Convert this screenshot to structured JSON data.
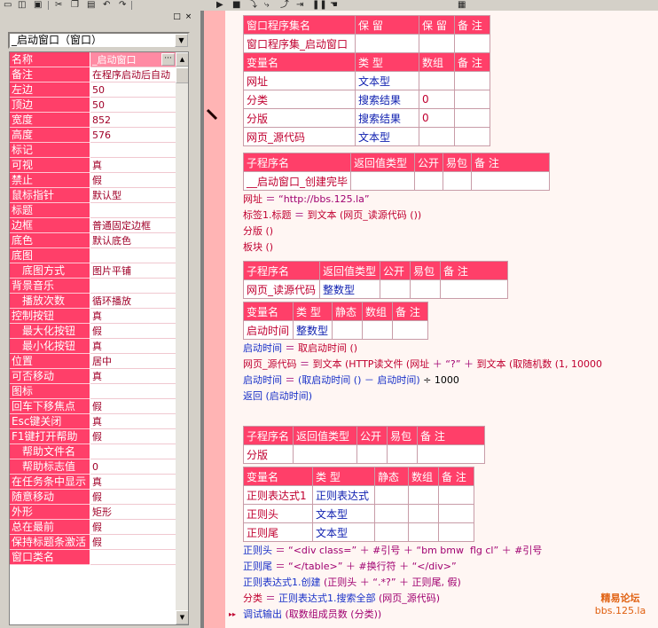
{
  "toolbar": {
    "icons": [
      "new-file-icon",
      "open-file-icon",
      "save-icon",
      "cut-icon",
      "copy-icon",
      "paste-icon",
      "undo-icon",
      "redo-icon",
      "run-icon",
      "stop-icon",
      "step-icon",
      "step-into-icon",
      "step-out-icon",
      "run-to-cursor-icon",
      "pause-icon",
      "hand-icon",
      "app-icon"
    ]
  },
  "left_panel": {
    "close_glyph": "×",
    "restore_glyph": "□",
    "object_selector": "_启动窗口（窗口）",
    "properties": [
      {
        "name": "名称",
        "value": "_启动窗口",
        "has_button": true
      },
      {
        "name": "备注",
        "value": "在程序启动后自动"
      },
      {
        "name": "左边",
        "value": "50"
      },
      {
        "name": "顶边",
        "value": "50"
      },
      {
        "name": "宽度",
        "value": "852"
      },
      {
        "name": "高度",
        "value": "576"
      },
      {
        "name": "标记",
        "value": ""
      },
      {
        "name": "可视",
        "value": "真"
      },
      {
        "name": "禁止",
        "value": "假"
      },
      {
        "name": "鼠标指针",
        "value": "默认型"
      },
      {
        "name": "标题",
        "value": ""
      },
      {
        "name": "边框",
        "value": "普通固定边框"
      },
      {
        "name": "底色",
        "value": "默认底色"
      },
      {
        "name": "底图",
        "value": ""
      },
      {
        "name": "底图方式",
        "value": "图片平铺",
        "sub": true
      },
      {
        "name": "背景音乐",
        "value": ""
      },
      {
        "name": "播放次数",
        "value": "循环播放",
        "sub": true
      },
      {
        "name": "控制按钮",
        "value": "真"
      },
      {
        "name": "最大化按钮",
        "value": "假",
        "sub": true
      },
      {
        "name": "最小化按钮",
        "value": "真",
        "sub": true
      },
      {
        "name": "位置",
        "value": "居中"
      },
      {
        "name": "可否移动",
        "value": "真"
      },
      {
        "name": "图标",
        "value": ""
      },
      {
        "name": "回车下移焦点",
        "value": "假"
      },
      {
        "name": "Esc键关闭",
        "value": "真"
      },
      {
        "name": "F1键打开帮助",
        "value": "假"
      },
      {
        "name": "帮助文件名",
        "value": "",
        "sub": true
      },
      {
        "name": "帮助标志值",
        "value": "0",
        "sub": true
      },
      {
        "name": "在任务条中显示",
        "value": "真"
      },
      {
        "name": "随意移动",
        "value": "假"
      },
      {
        "name": "外形",
        "value": "矩形"
      },
      {
        "name": "总在最前",
        "value": "假"
      },
      {
        "name": "保持标题条激活",
        "value": "假"
      },
      {
        "name": "窗口类名",
        "value": ""
      }
    ]
  },
  "editor": {
    "assembly_table": {
      "header": [
        "窗口程序集名",
        "保 留",
        "保 留",
        "备 注"
      ],
      "row": [
        "窗口程序集_启动窗口",
        "",
        "",
        ""
      ],
      "var_header": [
        "变量名",
        "类 型",
        "数组",
        "备 注"
      ],
      "vars": [
        [
          "网址",
          "文本型",
          "",
          ""
        ],
        [
          "分类",
          "搜索结果",
          "0",
          ""
        ],
        [
          "分版",
          "搜索结果",
          "0",
          ""
        ],
        [
          "网页_源代码",
          "文本型",
          "",
          ""
        ]
      ]
    },
    "sub1_table": {
      "header": [
        "子程序名",
        "返回值类型",
        "公开",
        "易包",
        "备 注"
      ],
      "row": [
        "__启动窗口_创建完毕",
        "",
        "",
        "",
        ""
      ]
    },
    "sub1_code": [
      "网址 ＝ “http://bbs.125.la”",
      "标签1.标题 ＝ 到文本 (网页_读源代码 ())",
      "分版 ()",
      "板块 ()"
    ],
    "sub2_table": {
      "header": [
        "子程序名",
        "返回值类型",
        "公开",
        "易包",
        "备 注"
      ],
      "row": [
        "网页_读源代码",
        "整数型",
        "",
        "",
        ""
      ],
      "var_header": [
        "变量名",
        "类 型",
        "静态",
        "数组",
        "备 注"
      ],
      "vars": [
        [
          "启动时间",
          "整数型",
          "",
          "",
          ""
        ]
      ]
    },
    "sub2_code": [
      "启动时间 ＝ 取启动时间 ()",
      "网页_源代码 ＝ 到文本 (HTTP读文件 (网址 ＋ “?” ＋ 到文本 (取随机数 (1, 10000",
      "启动时间 ＝ (取启动时间 () － 启动时间) ÷ 1000",
      "返回 (启动时间)"
    ],
    "sub3_table": {
      "header": [
        "子程序名",
        "返回值类型",
        "公开",
        "易包",
        "备 注"
      ],
      "row": [
        "分版",
        "",
        "",
        "",
        ""
      ],
      "var_header": [
        "变量名",
        "类 型",
        "静态",
        "数组",
        "备 注"
      ],
      "vars": [
        [
          "正则表达式1",
          "正则表达式",
          "",
          "",
          ""
        ],
        [
          "正则头",
          "文本型",
          "",
          "",
          ""
        ],
        [
          "正则尾",
          "文本型",
          "",
          "",
          ""
        ]
      ]
    },
    "sub3_code": [
      "正则头 ＝ “<div class=” ＋ #引号 ＋ “bm bmw  flg cl” ＋ #引号",
      "正则尾 ＝ “</table>” ＋ #换行符 ＋ “</div>”",
      "正则表达式1.创建 (正则头 ＋ “.*?” ＋ 正则尾, 假)",
      "分类 ＝ 正则表达式1.搜索全部 (网页_源代码)",
      "调试输出 (取数组成员数 (分类))"
    ],
    "current_line_marker": "▸▸"
  },
  "watermark": {
    "line1": "精易论坛",
    "line2": "bbs.125.la"
  }
}
